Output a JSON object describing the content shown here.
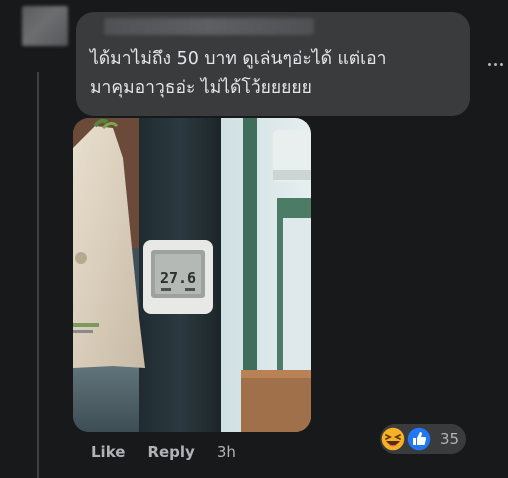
{
  "comment": {
    "author": "",
    "text": "ได้มาไม่ถึง 50 บาท ดูเล่นๆอ่ะได้ แต่เอา\nมาคุมอาวุธอ่ะ ไม่ได้โว้ยยยยย",
    "photo": {
      "thermometer_reading": "27.6"
    },
    "actions": {
      "like_label": "Like",
      "reply_label": "Reply",
      "timestamp": "3h"
    },
    "reactions": {
      "types": [
        "laughing-emoji",
        "like-thumbs-up"
      ],
      "count": "35"
    }
  },
  "colors": {
    "background": "#18191a",
    "bubble": "#3a3b3c",
    "primary_text": "#e4e6eb",
    "secondary_text": "#b0b3b8",
    "like_blue": "#2078f4",
    "haha_yellow": "#f7b125"
  }
}
